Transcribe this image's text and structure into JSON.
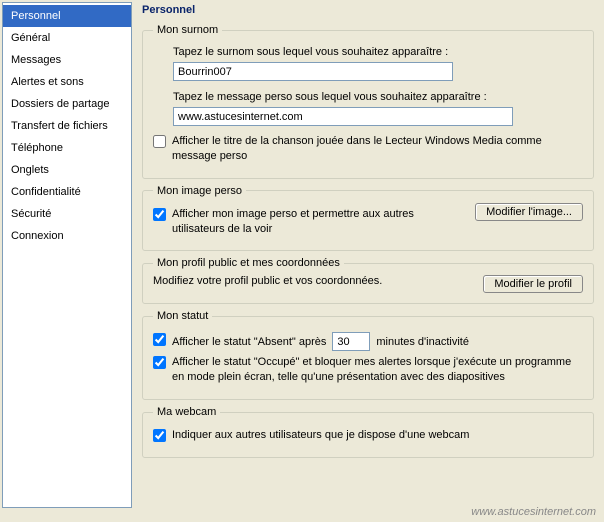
{
  "sidebar": {
    "items": [
      {
        "label": "Personnel",
        "selected": true
      },
      {
        "label": "Général"
      },
      {
        "label": "Messages"
      },
      {
        "label": "Alertes et sons"
      },
      {
        "label": "Dossiers de partage"
      },
      {
        "label": "Transfert de fichiers"
      },
      {
        "label": "Téléphone"
      },
      {
        "label": "Onglets"
      },
      {
        "label": "Confidentialité"
      },
      {
        "label": "Sécurité"
      },
      {
        "label": "Connexion"
      }
    ]
  },
  "main": {
    "title": "Personnel",
    "surnom": {
      "legend": "Mon surnom",
      "label1": "Tapez le surnom sous lequel vous souhaitez apparaître :",
      "value1": "Bourrin007",
      "label2": "Tapez le message perso sous lequel vous souhaitez apparaître :",
      "value2": "www.astucesinternet.com",
      "titre_checked": false,
      "titre_label": "Afficher le titre de la chanson jouée dans le Lecteur Windows Media comme message perso"
    },
    "image": {
      "legend": "Mon image perso",
      "show_checked": true,
      "show_label": "Afficher mon image perso et permettre aux autres utilisateurs de la voir",
      "button": "Modifier l'image..."
    },
    "profil": {
      "legend": "Mon profil public et mes coordonnées",
      "text": "Modifiez votre profil public et vos coordonnées.",
      "button": "Modifier le profil"
    },
    "statut": {
      "legend": "Mon statut",
      "absent_checked": true,
      "absent_pre": "Afficher le statut \"Absent\" après",
      "absent_value": "30",
      "absent_post": "minutes d'inactivité",
      "occupe_checked": true,
      "occupe_label": "Afficher le statut \"Occupé\" et bloquer mes alertes lorsque j'exécute un programme en mode plein écran, telle qu'une présentation avec des diapositives"
    },
    "webcam": {
      "legend": "Ma webcam",
      "checked": true,
      "label": "Indiquer aux autres utilisateurs que je dispose d'une webcam"
    }
  },
  "watermark": "www.astucesinternet.com"
}
